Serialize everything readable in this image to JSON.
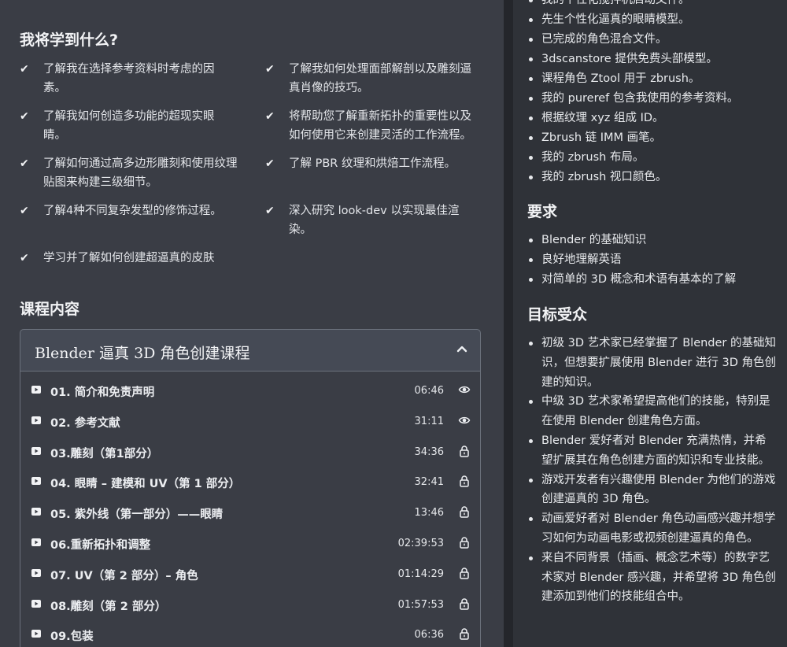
{
  "learn": {
    "title": "我将学到什么?",
    "items": [
      "了解我在选择参考资料时考虑的因素。",
      "了解我如何处理面部解剖以及雕刻逼真肖像的技巧。",
      "了解我如何创造多功能的超现实眼睛。",
      "将帮助您了解重新拓扑的重要性以及如何使用它来创建灵活的工作流程。",
      "了解如何通过高多边形雕刻和使用纹理贴图来构建三级细节。",
      "了解 PBR 纹理和烘焙工作流程。",
      "了解4种不同复杂发型的修饰过程。",
      "深入研究 look-dev 以实现最佳渲染。",
      "学习并了解如何创建超逼真的皮肤"
    ]
  },
  "course": {
    "section_title": "课程内容",
    "name": "Blender 逼真 3D 角色创建课程",
    "lessons": [
      {
        "title": "01. 简介和免责声明",
        "duration": "06:46",
        "state": "preview"
      },
      {
        "title": "02. 参考文献",
        "duration": "31:11",
        "state": "preview"
      },
      {
        "title": "03.雕刻（第1部分）",
        "duration": "34:36",
        "state": "locked"
      },
      {
        "title": "04. 眼睛 – 建模和 UV（第 1 部分）",
        "duration": "32:41",
        "state": "locked"
      },
      {
        "title": "05. 紫外线（第一部分）——眼睛",
        "duration": "13:46",
        "state": "locked"
      },
      {
        "title": "06.重新拓扑和调整",
        "duration": "02:39:53",
        "state": "locked"
      },
      {
        "title": "07. UV（第 2 部分）– 角色",
        "duration": "01:14:29",
        "state": "locked"
      },
      {
        "title": "08.雕刻（第 2 部分）",
        "duration": "01:57:53",
        "state": "locked"
      },
      {
        "title": "09.包装",
        "duration": "06:36",
        "state": "locked"
      }
    ]
  },
  "includes": [
    "我的个性化搅拌机启动文件。",
    "先生个性化逼真的眼睛模型。",
    "已完成的角色混合文件。",
    "3dscanstore 提供免费头部模型。",
    "课程角色 Ztool 用于 zbrush。",
    "我的 pureref 包含我使用的参考资料。",
    "根据纹理 xyz 组成 ID。",
    "Zbrush 链 IMM 画笔。",
    "我的 zbrush 布局。",
    "我的 zbrush 视口颜色。"
  ],
  "requirements": {
    "title": "要求",
    "items": [
      "Blender 的基础知识",
      "良好地理解英语",
      "对简单的 3D 概念和术语有基本的了解"
    ]
  },
  "audience": {
    "title": "目标受众",
    "items": [
      "初级 3D 艺术家已经掌握了 Blender 的基础知识，但想要扩展使用 Blender 进行 3D 角色创建的知识。",
      "中级 3D 艺术家希望提高他们的技能，特别是在使用 Blender 创建角色方面。",
      "Blender 爱好者对 Blender 充满热情，并希望扩展其在角色创建方面的知识和专业技能。",
      "游戏开发者有兴趣使用 Blender 为他们的游戏创建逼真的 3D 角色。",
      "动画爱好者对 Blender 角色动画感兴趣并想学习如何为动画电影或视频创建逼真的角色。",
      "来自不同背景（插画、概念艺术等）的数字艺术家对 Blender 感兴趣，并希望将 3D 角色创建添加到他们的技能组合中。"
    ]
  },
  "icons": {
    "check": "check-icon",
    "play": "play-icon",
    "preview": "eye-icon",
    "locked": "lock-icon",
    "collapse": "chevron-up-icon"
  }
}
